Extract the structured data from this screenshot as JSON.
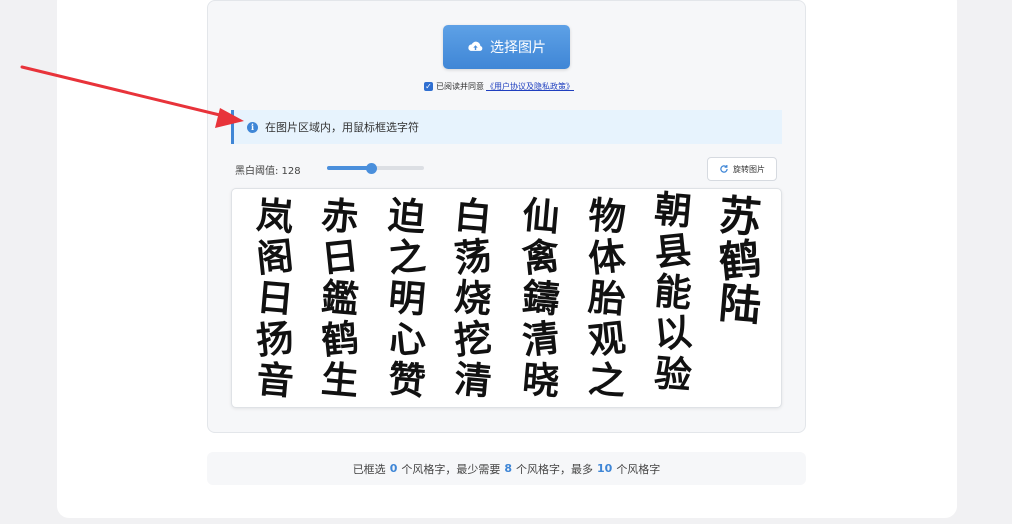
{
  "upload": {
    "button_label": "选择图片",
    "icon": "cloud-upload-icon"
  },
  "agreement": {
    "checked": true,
    "text": "已阅读并同意",
    "link_text": "《用户协议及隐私政策》"
  },
  "info": {
    "icon": "info-icon",
    "text": "在图片区域内，用鼠标框选字符"
  },
  "threshold": {
    "label": "黑白阈值: 128",
    "value": 128,
    "max": 255
  },
  "rotate": {
    "label": "旋转图片",
    "icon": "rotate-icon"
  },
  "image": {
    "columns": [
      "苏鹤陆",
      "朝县能以验",
      "物体胎观之",
      "仙禽鑄清晓",
      "白荡烧挖清",
      "迫之明心赞",
      "赤日鑑鹤生",
      "岚阁日扬音"
    ]
  },
  "status": {
    "prefix": "已框选",
    "selected_count": "0",
    "mid1": "个风格字，最少需要",
    "min_count": "8",
    "mid2": "个风格字，最多",
    "max_count": "10",
    "suffix": "个风格字"
  },
  "colors": {
    "accent": "#3f86d6",
    "arrow": "#e8333a"
  }
}
